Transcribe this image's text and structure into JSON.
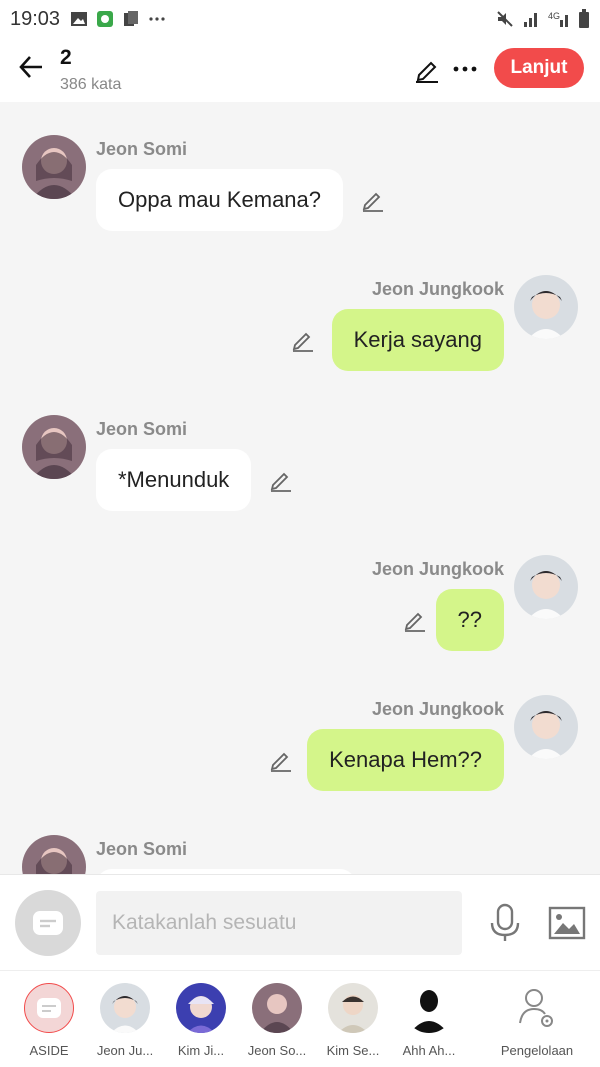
{
  "status_bar": {
    "time": "19:03",
    "icons": [
      "image-icon",
      "app-icon",
      "files-icon",
      "more-dots-icon",
      "mute-icon",
      "signal-icon",
      "4g-icon",
      "battery-icon"
    ]
  },
  "header": {
    "title": "2",
    "word_count": "386 kata",
    "next_label": "Lanjut",
    "accent_color": "#f24b4b"
  },
  "messages": [
    {
      "side": "left",
      "name": "Jeon Somi",
      "text": "Oppa mau Kemana?"
    },
    {
      "side": "right",
      "name": "Jeon Jungkook",
      "text": "Kerja sayang"
    },
    {
      "side": "left",
      "name": "Jeon Somi",
      "text": "*Menunduk"
    },
    {
      "side": "right",
      "name": "Jeon Jungkook",
      "text": "??"
    },
    {
      "side": "right",
      "name": "Jeon Jungkook",
      "text": "Kenapa Hem??"
    },
    {
      "side": "left",
      "name": "Jeon Somi",
      "text": ""
    }
  ],
  "input": {
    "placeholder": "Katakanlah sesuatu",
    "value": ""
  },
  "characters": [
    {
      "label": "ASIDE"
    },
    {
      "label": "Jeon Ju..."
    },
    {
      "label": "Kim Ji..."
    },
    {
      "label": "Jeon So..."
    },
    {
      "label": "Kim Se..."
    },
    {
      "label": "Ahh Ah..."
    },
    {
      "label": "Pengelolaan"
    }
  ],
  "colors": {
    "bubble_right": "#d4f58a",
    "bubble_left": "#ffffff",
    "background": "#f5f5f5"
  }
}
